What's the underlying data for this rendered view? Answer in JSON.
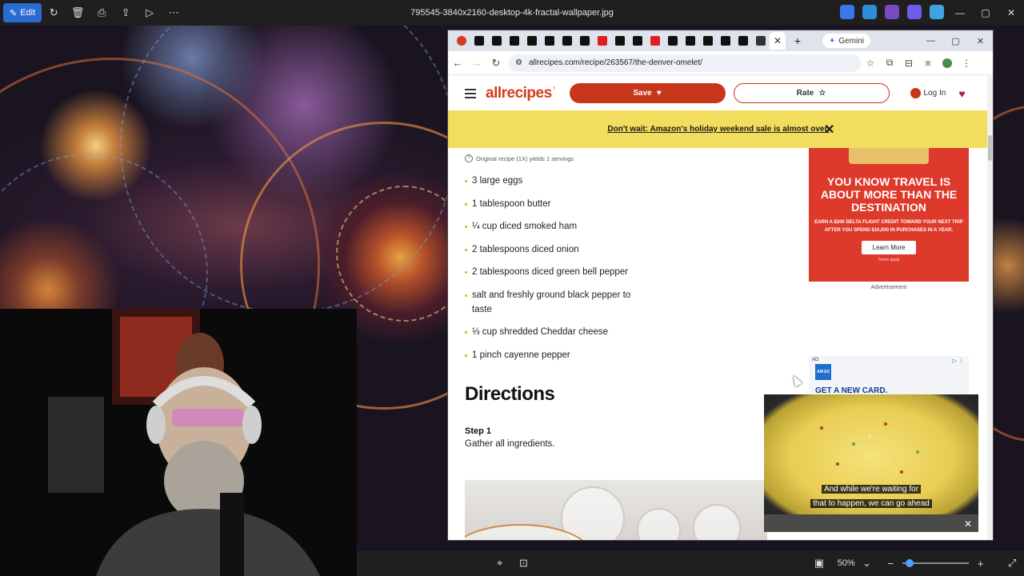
{
  "viewer": {
    "edit_label": "Edit",
    "file_title": "795545-3840x2160-desktop-4k-fractal-wallpaper.jpg",
    "zoom": "50%",
    "tray_colors": [
      "#3b78e7",
      "#2b8fd8",
      "#7a4ac2",
      "#6d5ce8",
      "#3fa3e0"
    ]
  },
  "browser": {
    "tab_count_icons": 20,
    "new_tab_label": "+",
    "gemini_label": "Gemini",
    "url": "allrecipes.com/recipe/263567/the-denver-omelet/"
  },
  "site": {
    "logo_text": "allrecipes",
    "save_label": "Save",
    "rate_label": "Rate",
    "login_label": "Log In",
    "promo_text": "Don't wait: Amazon's holiday weekend sale is almost over.",
    "yield_text": "Original recipe (1X) yields 1 servings",
    "ingredients": [
      "3 large eggs",
      "1 tablespoon butter",
      "¼ cup diced smoked ham",
      "2 tablespoons diced onion",
      "2 tablespoons diced green bell pepper",
      "salt and freshly ground black pepper to taste",
      "⅓ cup shredded Cheddar cheese",
      "1 pinch cayenne pepper"
    ],
    "directions_heading": "Directions",
    "step1_label": "Step 1",
    "step1_text": "Gather all ingredients."
  },
  "ads": {
    "ad1_heading": "YOU KNOW TRAVEL IS ABOUT MORE THAN THE DESTINATION",
    "ad1_sub": "EARN A $200 DELTA FLIGHT CREDIT TOWARD YOUR NEXT TRIP AFTER YOU SPEND $10,000 IN PURCHASES IN A YEAR.",
    "ad1_button": "Learn More",
    "ad1_terms": "Terms apply",
    "ad_label": "Advertisement",
    "ad2_tag": "AD",
    "ad2_logo": "AM EX",
    "ad2_heading": "GET A NEW CARD."
  },
  "video": {
    "caption_line1": "And while we're waiting for",
    "caption_line2": "that to happen, we can go ahead"
  }
}
